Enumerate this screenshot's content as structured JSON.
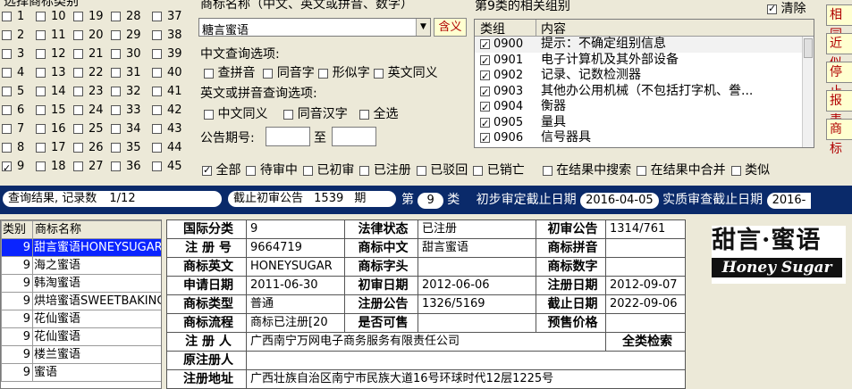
{
  "year_panel": {
    "title": "选择商标类别",
    "classes": [
      {
        "n": "1",
        "on": false
      },
      {
        "n": "10",
        "on": false
      },
      {
        "n": "19",
        "on": false
      },
      {
        "n": "28",
        "on": false
      },
      {
        "n": "37",
        "on": false
      },
      {
        "n": "2",
        "on": false
      },
      {
        "n": "11",
        "on": false
      },
      {
        "n": "20",
        "on": false
      },
      {
        "n": "29",
        "on": false
      },
      {
        "n": "38",
        "on": false
      },
      {
        "n": "3",
        "on": false
      },
      {
        "n": "12",
        "on": false
      },
      {
        "n": "21",
        "on": false
      },
      {
        "n": "30",
        "on": false
      },
      {
        "n": "39",
        "on": false
      },
      {
        "n": "4",
        "on": false
      },
      {
        "n": "13",
        "on": false
      },
      {
        "n": "22",
        "on": false
      },
      {
        "n": "31",
        "on": false
      },
      {
        "n": "40",
        "on": false
      },
      {
        "n": "5",
        "on": false
      },
      {
        "n": "14",
        "on": false
      },
      {
        "n": "23",
        "on": false
      },
      {
        "n": "32",
        "on": false
      },
      {
        "n": "41",
        "on": false
      },
      {
        "n": "6",
        "on": false
      },
      {
        "n": "15",
        "on": false
      },
      {
        "n": "24",
        "on": false
      },
      {
        "n": "33",
        "on": false
      },
      {
        "n": "42",
        "on": false
      },
      {
        "n": "7",
        "on": false
      },
      {
        "n": "16",
        "on": false
      },
      {
        "n": "25",
        "on": false
      },
      {
        "n": "34",
        "on": false
      },
      {
        "n": "43",
        "on": false
      },
      {
        "n": "8",
        "on": false
      },
      {
        "n": "17",
        "on": false
      },
      {
        "n": "26",
        "on": false
      },
      {
        "n": "35",
        "on": false
      },
      {
        "n": "44",
        "on": false
      },
      {
        "n": "9",
        "on": true
      },
      {
        "n": "18",
        "on": false
      },
      {
        "n": "27",
        "on": false
      },
      {
        "n": "36",
        "on": false
      },
      {
        "n": "45",
        "on": false
      }
    ]
  },
  "search": {
    "name_label": "商标名称（中文、英文或拼音、数字）",
    "name_value": "糖言蜜语",
    "contains_button": "含义",
    "cn_options_label": "中文查询选项:",
    "cn_options": [
      "查拼音",
      "同音字",
      "形似字",
      "英文同义"
    ],
    "en_options_label": "英文或拼音查询选项:",
    "en_options": [
      "中文同义",
      "同音汉字",
      "全选"
    ],
    "issue_label": "公告期号:",
    "issue_to": "至",
    "issue_from_value": "",
    "issue_to_value": ""
  },
  "groups": {
    "title": "第9类的相关组别",
    "clear_label": "清除",
    "col_group": "类组",
    "col_content": "内容",
    "rows": [
      {
        "code": "0900",
        "text": "提示：不确定组别信息"
      },
      {
        "code": "0901",
        "text": "电子计算机及其外部设备"
      },
      {
        "code": "0902",
        "text": "记录、记数检测器"
      },
      {
        "code": "0903",
        "text": "其他办公用机械（不包括打字机、誊..."
      },
      {
        "code": "0904",
        "text": "衡器"
      },
      {
        "code": "0905",
        "text": "量具"
      },
      {
        "code": "0906",
        "text": "信号器具"
      }
    ]
  },
  "side_buttons": [
    "相同",
    "近似",
    "停止",
    "报表",
    "商标"
  ],
  "filters": [
    "全部",
    "待审中",
    "已初审",
    "已注册",
    "已驳回",
    "已销亡",
    "在结果中搜索",
    "在结果中合并",
    "类似"
  ],
  "status": {
    "result_label": "查询结果, 记录数",
    "result_value": "1/12",
    "deadline_label": "截止初审公告",
    "deadline_value": "1539",
    "deadline_unit": "期",
    "class_prefix": "第",
    "class_value": "9",
    "class_suffix": "类",
    "prelim_label": "初步审定截止日期",
    "prelim_value": "2016-04-05",
    "exam_label": "实质审查截止日期",
    "exam_value": "2016-"
  },
  "results": {
    "col_class": "类别",
    "col_name": "商标名称",
    "rows": [
      {
        "cls": "9",
        "name": "甜言蜜语HONEYSUGAR"
      },
      {
        "cls": "9",
        "name": "海之蜜语"
      },
      {
        "cls": "9",
        "name": "韩淘蜜语"
      },
      {
        "cls": "9",
        "name": "烘培蜜语SWEETBAKING"
      },
      {
        "cls": "9",
        "name": "花仙蜜语"
      },
      {
        "cls": "9",
        "name": "花仙蜜语"
      },
      {
        "cls": "9",
        "name": "楼兰蜜语"
      },
      {
        "cls": "9",
        "name": "蜜语"
      }
    ]
  },
  "detail": {
    "intl_class_label": "国际分类",
    "intl_class": "9",
    "legal_label": "法律状态",
    "legal": "已注册",
    "prelim_label": "初审公告",
    "prelim": "1314/761",
    "reg_no_label": "注 册 号",
    "reg_no": "9664719",
    "cn_label": "商标中文",
    "cn": "甜言蜜语",
    "pinyin_label": "商标拼音",
    "pinyin": "",
    "en_label": "商标英文",
    "en": "HONEYSUGAR",
    "head_label": "商标字头",
    "head": "",
    "digit_label": "商标数字",
    "digit": "",
    "apply_label": "申请日期",
    "apply": "2011-06-30",
    "prelim_date_label": "初审日期",
    "prelim_date": "2012-06-06",
    "reg_date_label": "注册日期",
    "reg_date": "2012-09-07",
    "type_label": "商标类型",
    "type": "普通",
    "reg_notice_label": "注册公告",
    "reg_notice": "1326/5169",
    "expire_label": "截止日期",
    "expire": "2022-09-06",
    "flow_label": "商标流程",
    "flow": "商标已注册[20",
    "sale_label": "是否可售",
    "sale": "",
    "price_label": "预售价格",
    "price": "",
    "registrant_label": "注 册 人",
    "registrant": "广西南宁万网电子商务服务有限责任公司",
    "all_search": "全类检索",
    "orig_label": "原注册人",
    "orig": "",
    "addr_label": "注册地址",
    "addr": "广西壮族自治区南宁市民族大道16号环球时代12层1225号"
  },
  "logo": {
    "cn": "甜言·蜜语",
    "en": "Honey Sugar"
  }
}
